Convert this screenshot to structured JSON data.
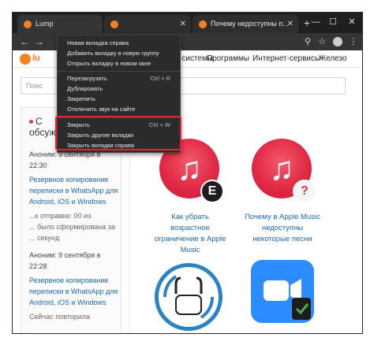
{
  "browser": {
    "tabs": [
      {
        "title": "Lump",
        "active": true
      },
      {
        "title": "",
        "active": false
      },
      {
        "title": "Почему недоступны п...",
        "active": false
      }
    ],
    "new_tab_label": "+",
    "window_controls": {
      "minimize": "—",
      "maximize": "☐",
      "close": "✕"
    },
    "tab_close": "✕"
  },
  "context_menu": {
    "items": [
      {
        "label": "Новая вкладка справа",
        "shortcut": ""
      },
      {
        "label": "Добавить вкладку в новую группу",
        "shortcut": ""
      },
      {
        "label": "Открыть вкладку в новом окне",
        "shortcut": ""
      },
      {
        "label": "Перезагрузить",
        "shortcut": "Ctrl + R"
      },
      {
        "label": "Дублировать",
        "shortcut": ""
      },
      {
        "label": "Закрепить",
        "shortcut": ""
      },
      {
        "label": "Отключить звук на сайте",
        "shortcut": ""
      },
      {
        "label": "Закрыть",
        "shortcut": "Ctrl + W"
      },
      {
        "label": "Закрыть другие вкладки",
        "shortcut": ""
      },
      {
        "label": "Закрыть вкладки справа",
        "shortcut": ""
      }
    ],
    "highlight_color": "#e8232f"
  },
  "site": {
    "logo_text": "lu",
    "nav": [
      "е системы",
      "Программы",
      "Интернет-сервисы",
      "Железо"
    ],
    "search_placeholder": "Поис",
    "discussion": {
      "title_line1": "С",
      "title_line2": "обсуждаем",
      "comments": [
        {
          "author": "Аноним: 9 сентября в",
          "time": "22:30",
          "link": [
            "Резервное копирование",
            "переписки в WhatsApp для",
            "Android, iOS и Windows"
          ],
          "text": [
            "...к отправке: 00 из",
            "... было сформирована за",
            "... секунд"
          ]
        },
        {
          "author": "Аноним: 9 сентября в",
          "time": "22:28",
          "link": [
            "Резервное копирование",
            "переписки в WhatsApp для",
            "Android, iOS и Windows"
          ],
          "text": [
            "Сейчас повторила"
          ]
        }
      ]
    },
    "cards": [
      {
        "title": [
          "Как убрать",
          "возрастное",
          "ограничение в Apple",
          "Music"
        ],
        "badge": "E"
      },
      {
        "title": [
          "Почему в Apple Music",
          "недоступны",
          "некоторые песни"
        ],
        "badge": "?"
      }
    ]
  },
  "colors": {
    "accent": "#f58220",
    "link": "#1a66b8",
    "itunes_red": "#e22a45",
    "zoom_blue": "#2d8cff"
  }
}
